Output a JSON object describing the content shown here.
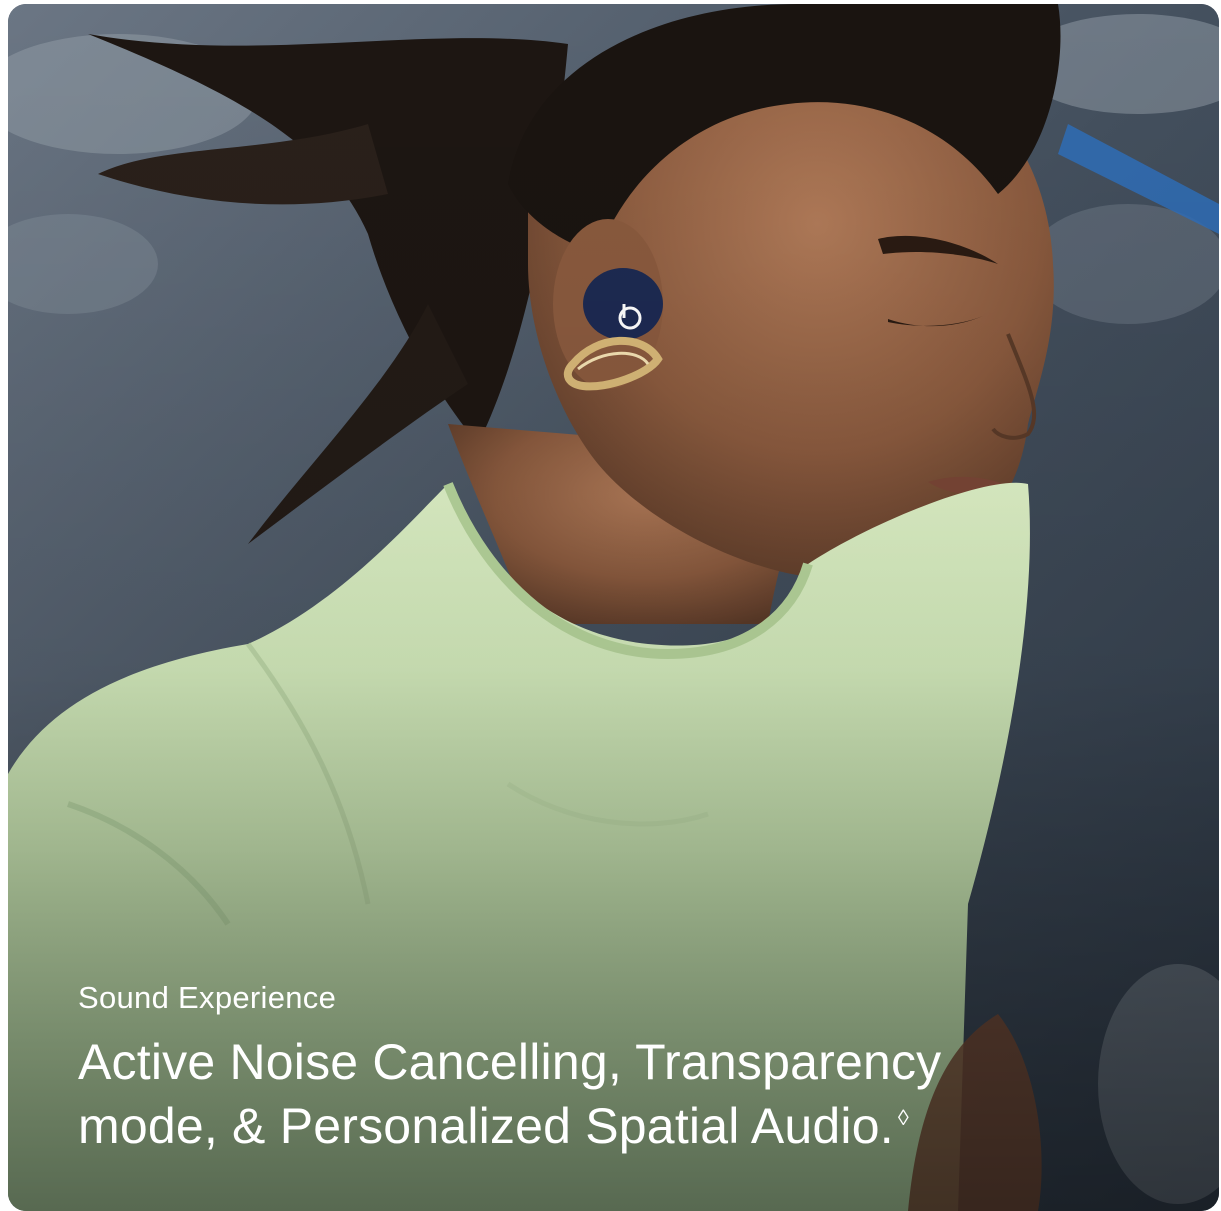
{
  "card": {
    "image_alt": "Woman running with a blue earbud and gold ear cuff",
    "eyebrow": "Sound Experience",
    "headline_line1": "Active Noise Cancelling, Transparency",
    "headline_line2": "mode, & Personalized Spatial Audio.",
    "footnote_mark": "◊"
  },
  "colors": {
    "text": "#ffffff",
    "shirt": "#cfe8b8",
    "earbud": "#1d2a52",
    "road": "#3e4a58"
  }
}
